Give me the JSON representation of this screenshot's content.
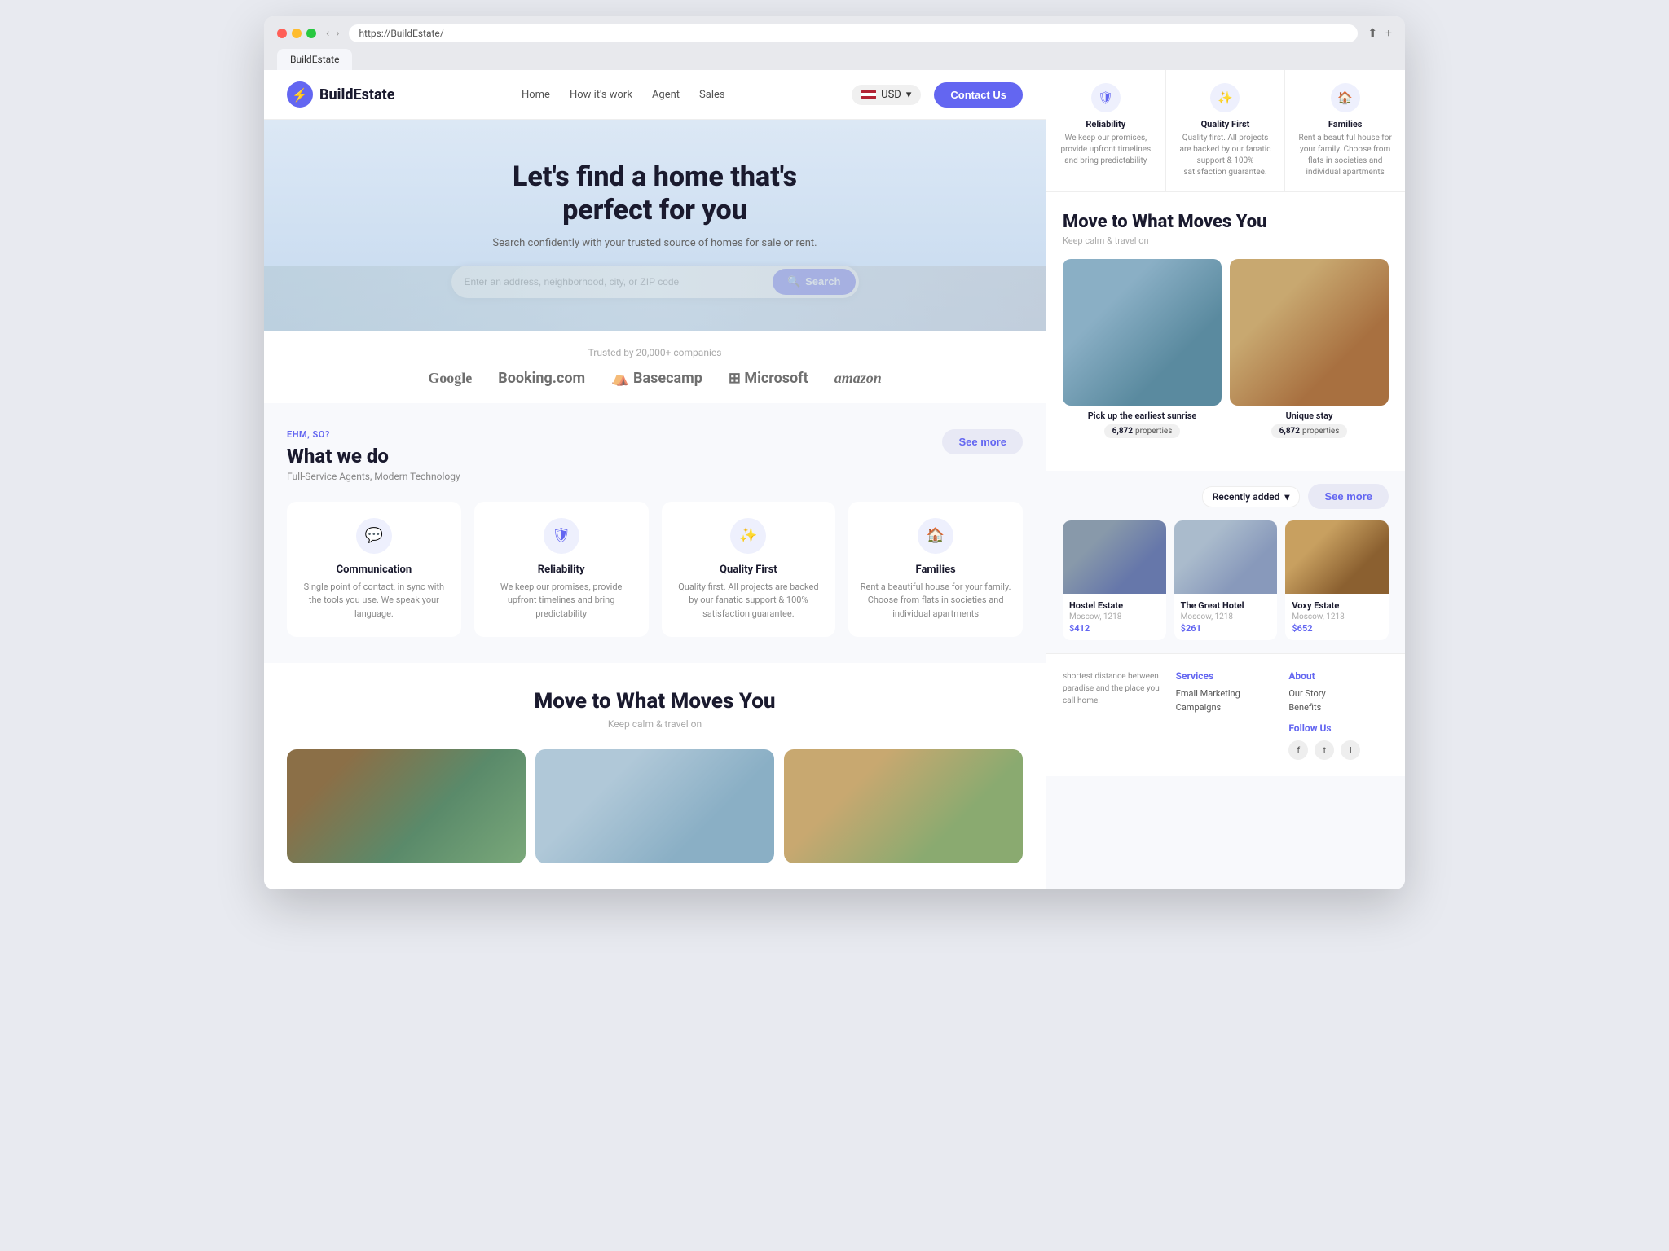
{
  "browser": {
    "url": "https://BuildEstate/",
    "tab_label": "BuildEstate"
  },
  "navbar": {
    "logo_text_build": "Build",
    "logo_text_estate": "Estate",
    "nav_home": "Home",
    "nav_how": "How it's work",
    "nav_agent": "Agent",
    "nav_sales": "Sales",
    "currency": "USD",
    "contact_btn": "Contact Us"
  },
  "hero": {
    "title": "Let's find a home that's perfect for you",
    "subtitle": "Search confidently with your trusted source of homes for sale or rent.",
    "search_placeholder": "Enter an address, neighborhood, city, or ZIP code",
    "search_btn": "Search"
  },
  "trust": {
    "label": "Trusted by 20,000+ companies",
    "logos": [
      "Google",
      "Booking.com",
      "Basecamp",
      "Microsoft",
      "amazon"
    ]
  },
  "what_we_do": {
    "eyebrow": "EHM, SO?",
    "title": "What we do",
    "desc": "Full-Service Agents, Modern Technology",
    "see_more": "See more",
    "features": [
      {
        "icon": "💬",
        "title": "Communication",
        "desc": "Single point of contact, in sync with the tools you use. We speak your language."
      },
      {
        "icon": "🛡",
        "title": "Reliability",
        "desc": "We keep our promises, provide upfront timelines and bring predictability"
      },
      {
        "icon": "✨",
        "title": "Quality First",
        "desc": "Quality first. All projects are backed by our fanatic support & 100% satisfaction guarantee."
      },
      {
        "icon": "🏠",
        "title": "Families",
        "desc": "Rent a beautiful house for your family. Choose from flats in societies and individual apartments"
      }
    ]
  },
  "move_section": {
    "title": "Move to What Moves You",
    "subtitle": "Keep calm & travel on"
  },
  "right_top_cards": [
    {
      "icon": "🛡",
      "title": "Reliability",
      "desc": "We keep our promises, provide upfront timelines and bring predictability"
    },
    {
      "icon": "✨",
      "title": "Quality First",
      "desc": "Quality first. All projects are backed by our fanatic support & 100% satisfaction guarantee."
    },
    {
      "icon": "🏠",
      "title": "Families",
      "desc": "Rent a beautiful house for your family. Choose from flats in societies and individual apartments"
    }
  ],
  "right_move": {
    "title": "Move to What Moves You",
    "subtitle": "Keep calm & travel on",
    "cards": [
      {
        "label": "Pick up the earliest sunrise",
        "properties_count": "6,872",
        "properties_label": "properties"
      },
      {
        "label": "Unique stay",
        "properties_count": "6,872",
        "properties_label": "properties"
      }
    ]
  },
  "recently_added": {
    "dropdown_label": "Recently added",
    "see_more": "See more",
    "properties": [
      {
        "name": "Hostel Estate",
        "location": "Moscow, 1218",
        "price": "$412"
      },
      {
        "name": "The Great Hotel",
        "location": "Moscow, 1218",
        "price": "$261"
      },
      {
        "name": "Voxy Estate",
        "location": "Moscow, 1218",
        "price": "$652"
      }
    ]
  },
  "footer": {
    "tagline": "shortest distance between paradise and the place you call home.",
    "services": {
      "title": "Services",
      "items": [
        "Email Marketing",
        "Campaigns"
      ]
    },
    "about": {
      "title": "About",
      "items": [
        "Our Story",
        "Benefits"
      ]
    },
    "follow": {
      "title": "Follow Us",
      "icons": [
        "f",
        "t",
        "i"
      ]
    }
  }
}
